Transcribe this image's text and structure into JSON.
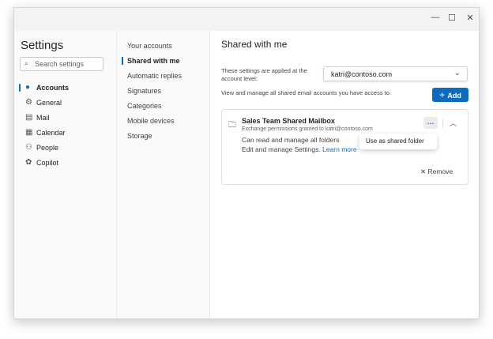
{
  "window": {
    "controls": [
      "minimize",
      "maximize",
      "close"
    ]
  },
  "sidebar": {
    "title": "Settings",
    "search_placeholder": "Search settings",
    "items": [
      {
        "label": "Accounts",
        "icon": "person-icon",
        "selected": true
      },
      {
        "label": "General",
        "icon": "gear-icon"
      },
      {
        "label": "Mail",
        "icon": "mail-icon"
      },
      {
        "label": "Calendar",
        "icon": "calendar-icon"
      },
      {
        "label": "People",
        "icon": "people-icon"
      },
      {
        "label": "Copilot",
        "icon": "copilot-icon"
      }
    ]
  },
  "subnav": {
    "items": [
      {
        "label": "Your accounts"
      },
      {
        "label": "Shared with me",
        "selected": true
      },
      {
        "label": "Automatic replies"
      },
      {
        "label": "Signatures"
      },
      {
        "label": "Categories"
      },
      {
        "label": "Mobile devices"
      },
      {
        "label": "Storage"
      }
    ]
  },
  "main": {
    "title": "Shared with me",
    "applied_note": "These settings are applied at the account level:",
    "account": "katri@contoso.com",
    "view_note": "View and manage all shared email accounts you have access to.",
    "add_label": "Add",
    "card": {
      "name": "Sales Team Shared Mailbox",
      "granted": "Exchange permissions granted to katri@contoso.com",
      "perm1": "Can read and manage all folders",
      "perm2": "Edit and manage Settings.",
      "learn_more": "Learn more",
      "remove": "Remove",
      "menu_item": "Use as shared folder"
    }
  },
  "colors": {
    "accent": "#0f6cbd"
  }
}
